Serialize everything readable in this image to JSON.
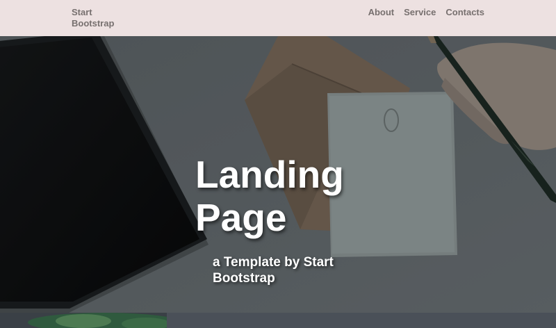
{
  "navbar": {
    "brand": "Start Bootstrap",
    "links": [
      {
        "label": "About"
      },
      {
        "label": "Service"
      },
      {
        "label": "Contacts"
      }
    ]
  },
  "hero": {
    "title": "Landing Page",
    "subtitle": "a Template by Start Bootstrap",
    "background_photo": "desk-with-tablet-envelope-notecard-and-pencil"
  },
  "colors": {
    "navbar_bg": "#ede1e1",
    "nav_text": "#77706f",
    "hero_text": "#ffffff"
  }
}
